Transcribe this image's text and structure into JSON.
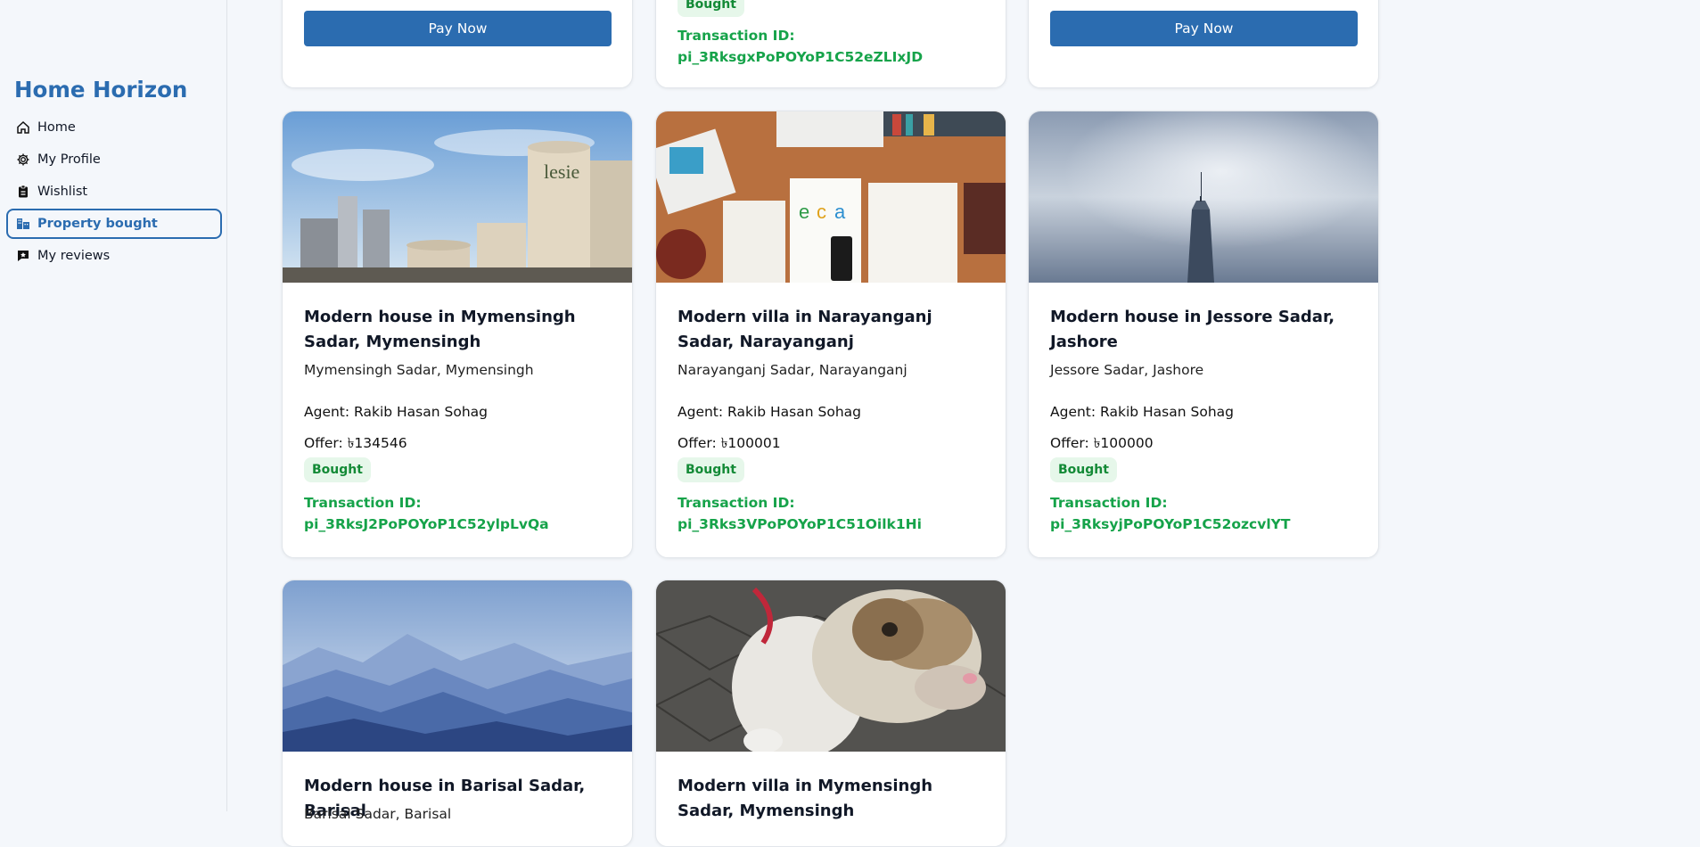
{
  "sidebar": {
    "brand": "Home Horizon",
    "items": [
      {
        "label": "Home"
      },
      {
        "label": "My Profile"
      },
      {
        "label": "Wishlist"
      },
      {
        "label": "Property bought"
      },
      {
        "label": "My reviews"
      }
    ]
  },
  "top_row": {
    "pay_label": "Pay Now",
    "badge": "Bought",
    "txn_label": "Transaction ID:",
    "txn_id": "pi_3RksgxPoPOYoP1C52eZLIxJD"
  },
  "cards": [
    {
      "title": "Modern house in Mymensingh Sadar, Mymensingh",
      "location": "Mymensingh Sadar, Mymensingh",
      "agent_label": "Agent:",
      "agent": "Rakib Hasan Sohag",
      "offer_label": "Offer:",
      "offer": "৳134546",
      "status": "Bought",
      "txn_label": "Transaction ID:",
      "txn_id": "pi_3RksJ2PoPOYoP1C52ylpLvQa",
      "image": "industrial-factory"
    },
    {
      "title": "Modern villa in Narayanganj Sadar, Narayanganj",
      "location": "Narayanganj Sadar, Narayanganj",
      "agent_label": "Agent:",
      "agent": "Rakib Hasan Sohag",
      "offer_label": "Offer:",
      "offer": "৳100001",
      "status": "Bought",
      "txn_label": "Transaction ID:",
      "txn_id": "pi_3Rks3VPoPOYoP1C51Oilk1Hi",
      "image": "desk-workspace"
    },
    {
      "title": "Modern house in Jessore Sadar, Jashore",
      "location": "Jessore Sadar, Jashore",
      "agent_label": "Agent:",
      "agent": "Rakib Hasan Sohag",
      "offer_label": "Offer:",
      "offer": "৳100000",
      "status": "Bought",
      "txn_label": "Transaction ID:",
      "txn_id": "pi_3RksyjPoPOYoP1C52ozcvlYT",
      "image": "skyscraper-sky"
    },
    {
      "title": "Modern house in Barisal Sadar, Barisal",
      "location": "Barisal Sadar, Barisal",
      "image": "blue-mountains"
    },
    {
      "title": "Modern villa in Mymensingh Sadar, Mymensingh",
      "image": "bulldog"
    }
  ],
  "colors": {
    "accent": "#2b6cb0",
    "success": "#16a34a",
    "badge_bg": "#e6f7ea",
    "page_bg": "#f4f7fb"
  }
}
